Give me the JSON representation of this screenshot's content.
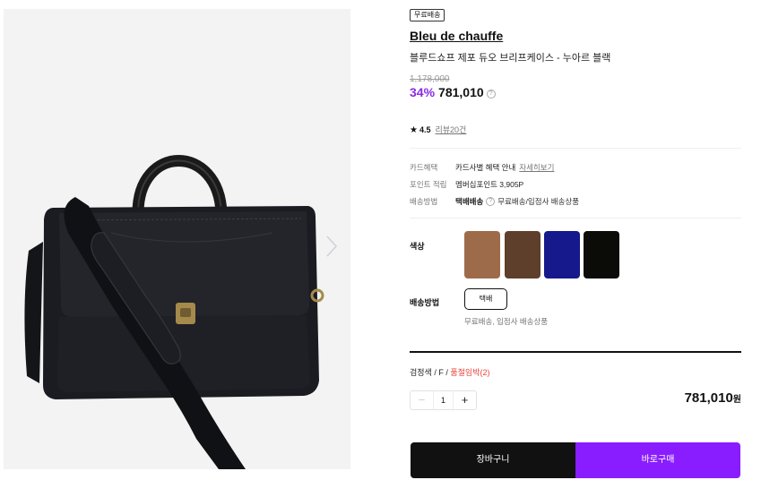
{
  "product": {
    "badge": "무료배송",
    "brand": "Bleu de chauffe",
    "name": "블루드쇼프 제포 듀오 브리프케이스 - 누아르 블랙",
    "original_price": "1,178,000",
    "discount": "34%",
    "price": "781,010",
    "help_icon": "?"
  },
  "rating": {
    "star_icon": "★",
    "score": "4.5",
    "review_link": "리뷰20건"
  },
  "benefits": {
    "card_label": "카드혜택",
    "card_value": "카드사별 혜택 안내",
    "card_link": "자세히보기",
    "point_label": "포인트 적립",
    "point_value": "멤버십포인트 3,905P",
    "delivery_label": "배송방법",
    "delivery_method": "택배배송",
    "delivery_note": "무료배송/입점사 배송상품"
  },
  "options": {
    "color_label": "색상",
    "colors": [
      "#9e6b4a",
      "#5e3f2b",
      "#15198c",
      "#0b0c08"
    ],
    "shipping_label": "배송방법",
    "shipping_option": "택배",
    "shipping_note": "무료배송, 입점사 배송상품"
  },
  "selection": {
    "summary": "검정색 / F / ",
    "stock_warning": "품절임박(2)",
    "quantity": "1",
    "minus": "−",
    "plus": "+",
    "total_price": "781,010",
    "currency": "원"
  },
  "actions": {
    "cart": "장바구니",
    "buy": "바로구매"
  }
}
